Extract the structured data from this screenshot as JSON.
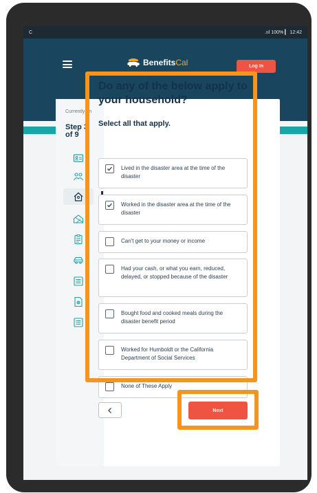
{
  "statusbar": {
    "left_glyph": "С",
    "right_text": ".ııl 100% ▎ 12:42"
  },
  "header": {
    "logo_main": "Benefits",
    "logo_accent": "Cal",
    "login_label": "Log In"
  },
  "sidebar": {
    "current_label": "Currently on",
    "step_label": "Step 3 of 9",
    "icons": [
      "id-card-icon",
      "people-icon",
      "house-icon",
      "disaster-icon",
      "clipboard-icon",
      "car-icon",
      "list-icon",
      "document-icon",
      "summary-icon"
    ],
    "active_index": 2
  },
  "question": {
    "title": "Do any of the below apply to your household?",
    "instruction": "Select all that apply.",
    "options": [
      {
        "label": "Lived in the disaster area at the time of the disaster",
        "checked": true
      },
      {
        "label": "Worked in the disaster area at the time of the disaster",
        "checked": true
      },
      {
        "label": "Can't get to your money or income",
        "checked": false
      },
      {
        "label": "Had your cash, or what you earn, reduced, delayed, or stopped because of the disaster",
        "checked": false
      },
      {
        "label": "Bought food and cooked meals during the disaster benefit period",
        "checked": false
      },
      {
        "label": "Worked for Humboldt or the California Department of Social Services",
        "checked": false
      },
      {
        "label": "None of These Apply",
        "checked": false
      }
    ]
  },
  "nav": {
    "back_icon": "chevron-left-icon",
    "next_label": "Next"
  },
  "colors": {
    "header": "#19465e",
    "accent": "#ef5341",
    "teal": "#1aa6a6",
    "highlight": "#f7941d",
    "text": "#14324a"
  }
}
